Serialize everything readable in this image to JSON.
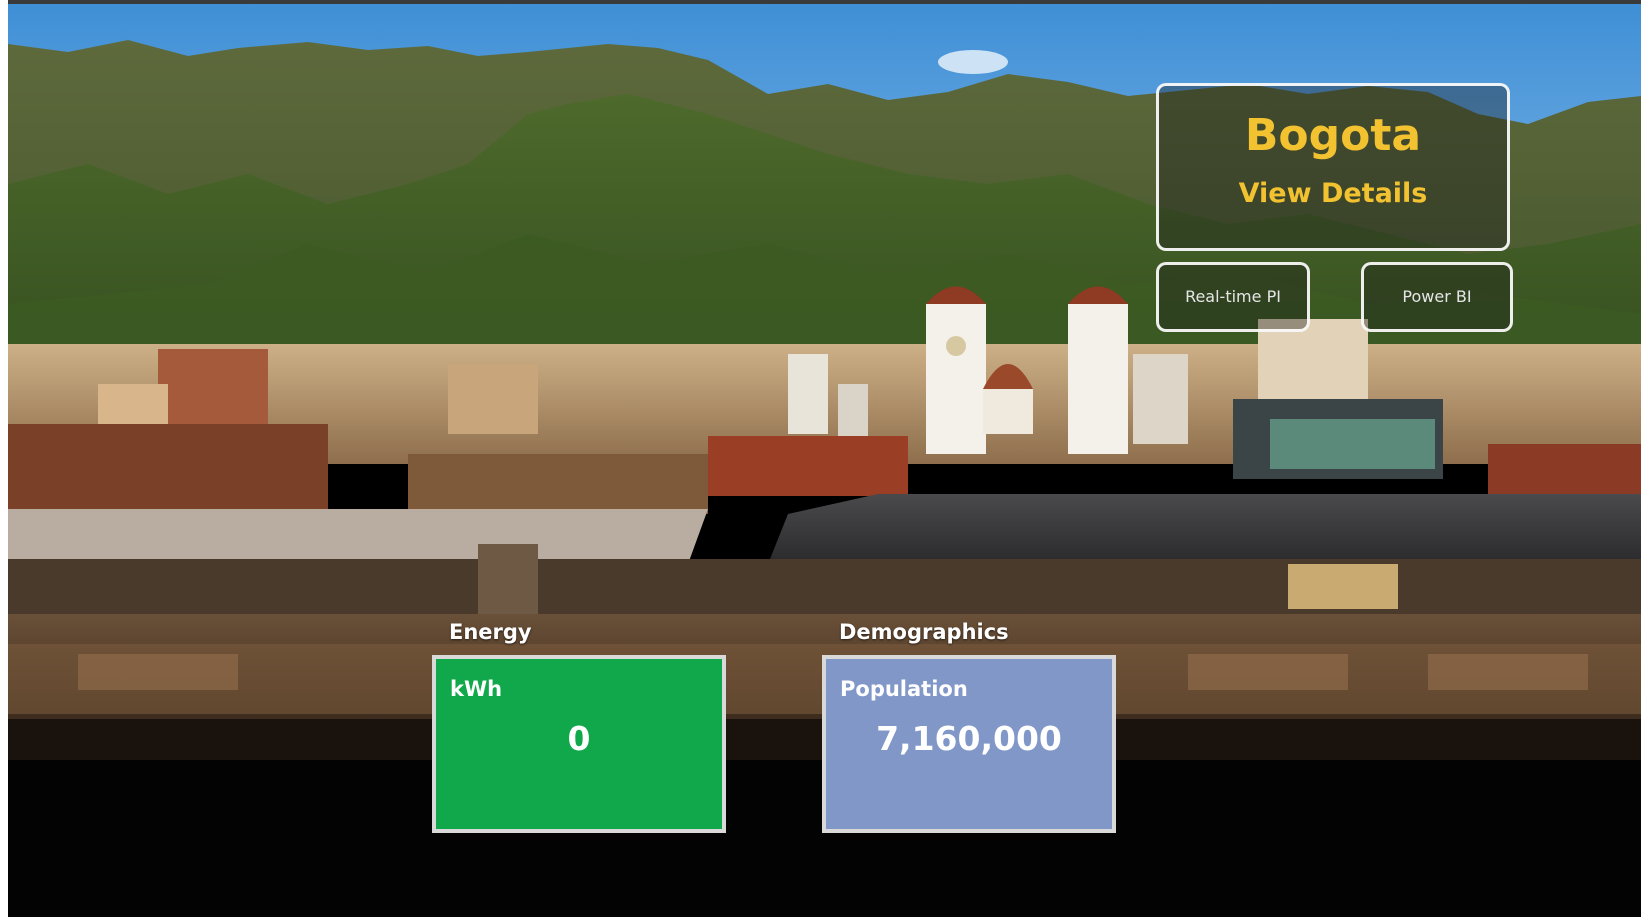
{
  "city_panel": {
    "title": "Bogota",
    "link_label": "View Details"
  },
  "buttons": {
    "realtime_label": "Real-time PI",
    "powerbi_label": "Power BI"
  },
  "energy": {
    "heading": "Energy",
    "label": "kWh",
    "value": "0",
    "color": "#10a84a"
  },
  "demographics": {
    "heading": "Demographics",
    "label": "Population",
    "value": "7,160,000",
    "color": "#8097c8"
  }
}
